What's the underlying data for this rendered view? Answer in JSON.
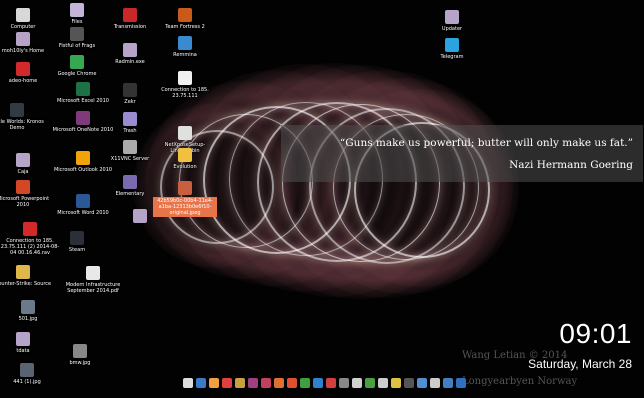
{
  "desktop": {
    "icons": [
      {
        "label": "Computer",
        "icon": "computer-icon",
        "color": "#d8d8d8"
      },
      {
        "label": "moh10ly's Home",
        "icon": "home-folder-icon",
        "color": "#b5a4c8"
      },
      {
        "label": "adeo-home",
        "icon": "remote-desktop-icon",
        "color": "#d22a2a"
      },
      {
        "label": "Battle Worlds: Kronos Demo",
        "icon": "steam-icon",
        "color": "#333a44"
      },
      {
        "label": "Caja",
        "icon": "file-manager-icon",
        "color": "#b5a4c8"
      },
      {
        "label": "Microsoft Powerpoint 2010",
        "icon": "powerpoint-icon",
        "color": "#d24726"
      },
      {
        "label": "Connection to 185. 23.75.111 (2) 2014-08-04 00.16.46.rav",
        "icon": "remote-desktop-icon",
        "color": "#d22a2a"
      },
      {
        "label": "Counter-Strike: Source",
        "icon": "counter-strike-icon",
        "color": "#e0b84a"
      },
      {
        "label": "501.jpg",
        "icon": "image-file-icon",
        "color": "#6a7a8a"
      },
      {
        "label": "tdata",
        "icon": "folder-icon",
        "color": "#b5a4c8"
      },
      {
        "label": "441 (1).jpg",
        "icon": "image-file-icon",
        "color": "#5a6470"
      },
      {
        "label": "Files",
        "icon": "files-icon",
        "color": "#c4b4d8"
      },
      {
        "label": "Fistful of Frags",
        "icon": "steam-icon",
        "color": "#555"
      },
      {
        "label": "Google Chrome",
        "icon": "chrome-icon",
        "color": "#37a852"
      },
      {
        "label": "Microsoft Excel 2010",
        "icon": "excel-icon",
        "color": "#1e7145"
      },
      {
        "label": "Microsoft OneNote 2010",
        "icon": "onenote-icon",
        "color": "#80397b"
      },
      {
        "label": "Microsoft Outlook 2010",
        "icon": "outlook-icon",
        "color": "#f0a30a"
      },
      {
        "label": "Microsoft Word 2010",
        "icon": "word-icon",
        "color": "#2b5797"
      },
      {
        "label": "Steam",
        "icon": "steam-icon",
        "color": "#2a2f38"
      },
      {
        "label": "Modern Infrastructure September 2014.pdf",
        "icon": "pdf-file-icon",
        "color": "#e8e8e8"
      },
      {
        "label": "bmw.jpg",
        "icon": "image-file-icon",
        "color": "#888"
      },
      {
        "label": "Transmission",
        "icon": "transmission-icon",
        "color": "#c8282a"
      },
      {
        "label": "Radmin.exe",
        "icon": "exe-file-icon",
        "color": "#b5a4c8"
      },
      {
        "label": "Zekr",
        "icon": "zekr-icon",
        "color": "#333"
      },
      {
        "label": "Trash",
        "icon": "trash-icon",
        "color": "#9a8ad0"
      },
      {
        "label": "X11VNC Server",
        "icon": "vnc-icon",
        "color": "#aaa"
      },
      {
        "label": "Elementary",
        "icon": "image-file-icon",
        "color": "#7a6ab0"
      },
      {
        "label": "",
        "icon": "folder-icon",
        "color": "#b5a4c8"
      },
      {
        "label": "Team Fortress 2",
        "icon": "team-fortress-icon",
        "color": "#c85a1a"
      },
      {
        "label": "Remmina",
        "icon": "remmina-icon",
        "color": "#3a8ad0"
      },
      {
        "label": "Connection to 185. 23.75.111",
        "icon": "document-file-icon",
        "color": "#f0f0f0"
      },
      {
        "label": "NetXposeSetup-Linux64.bin",
        "icon": "binary-file-icon",
        "color": "#e0e0e0"
      },
      {
        "label": "Evolution",
        "icon": "evolution-icon",
        "color": "#f0c040"
      },
      {
        "label": "42b59b0c-00b4-11e4-a1ba-12313b0e6f10-original.jpeg",
        "icon": "image-file-icon",
        "color": "#c86040"
      },
      {
        "label": "Updater",
        "icon": "updater-icon",
        "color": "#b5a4c8"
      },
      {
        "label": "Telegram",
        "icon": "telegram-icon",
        "color": "#2aa3e0"
      }
    ]
  },
  "quote": {
    "text": "“Guns make us powerful; butter will only make us fat.”",
    "author": "Nazi Hermann Goering"
  },
  "clock": {
    "time": "09:01",
    "date": "Saturday, March 28"
  },
  "watermark": {
    "name": "Wang Letian © 2014",
    "place": "Longyearbyen Norway"
  },
  "dock": {
    "items": [
      {
        "icon": "dash-icon",
        "color": "#dddddd"
      },
      {
        "icon": "debian-icon",
        "color": "#3a7ac8"
      },
      {
        "icon": "files-icon",
        "color": "#f0a040"
      },
      {
        "icon": "chrome-icon",
        "color": "#e04040"
      },
      {
        "icon": "gimp-icon",
        "color": "#c8a040"
      },
      {
        "icon": "teamviewer-icon",
        "color": "#a04080"
      },
      {
        "icon": "onenote-icon",
        "color": "#c04060"
      },
      {
        "icon": "powerpoint-icon",
        "color": "#e07030"
      },
      {
        "icon": "flag-icon",
        "color": "#e05030"
      },
      {
        "icon": "settings-icon",
        "color": "#40a040"
      },
      {
        "icon": "skype-icon",
        "color": "#3080d0"
      },
      {
        "icon": "transmission-icon",
        "color": "#d04040"
      },
      {
        "icon": "calculator-icon",
        "color": "#888888"
      },
      {
        "icon": "mail-icon",
        "color": "#d0d0d0"
      },
      {
        "icon": "gear-icon",
        "color": "#4aa040"
      },
      {
        "icon": "document-icon",
        "color": "#cccccc"
      },
      {
        "icon": "folder-icon",
        "color": "#e0c040"
      },
      {
        "icon": "terminal-icon",
        "color": "#555555"
      },
      {
        "icon": "image-viewer-icon",
        "color": "#5090d0"
      },
      {
        "icon": "search-icon",
        "color": "#cccccc"
      },
      {
        "icon": "monitor-icon",
        "color": "#4080c0"
      },
      {
        "icon": "bluetooth-icon",
        "color": "#3070c0"
      }
    ]
  }
}
